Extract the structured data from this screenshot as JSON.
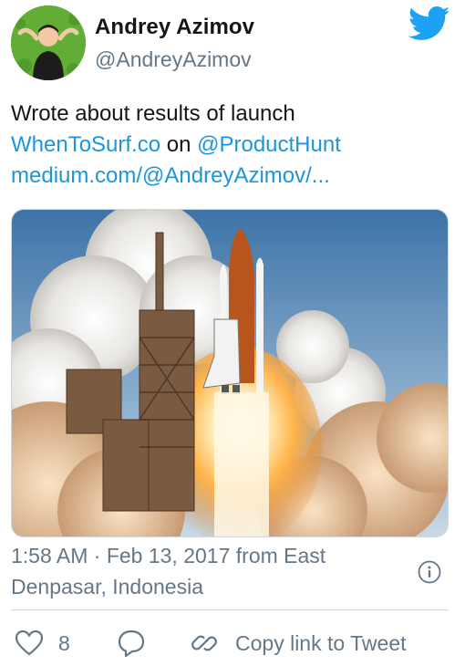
{
  "author": {
    "display_name": "Andrey Azimov",
    "handle": "@AndreyAzimov"
  },
  "icons": {
    "brand": "twitter-bird-icon",
    "info": "info-icon",
    "like": "heart-icon",
    "reply": "speech-bubble-icon",
    "copy_link": "link-icon"
  },
  "tweet": {
    "line1": "Wrote about results of launch",
    "link_site": "WhenToSurf.co",
    "word_on": " on ",
    "mention": "@ProductHunt",
    "link_medium": "medium.com/@AndreyAzimov/..."
  },
  "meta": {
    "time_location": "1:58 AM · Feb 13, 2017 from East Denpasar, Indonesia"
  },
  "actions": {
    "like_count": "8",
    "copy_link_label": "Copy link to Tweet"
  },
  "colors": {
    "link": "#1b95e0",
    "brand": "#1da1f2",
    "muted": "#657786",
    "text": "#14171a",
    "border": "#ccd6dd"
  }
}
